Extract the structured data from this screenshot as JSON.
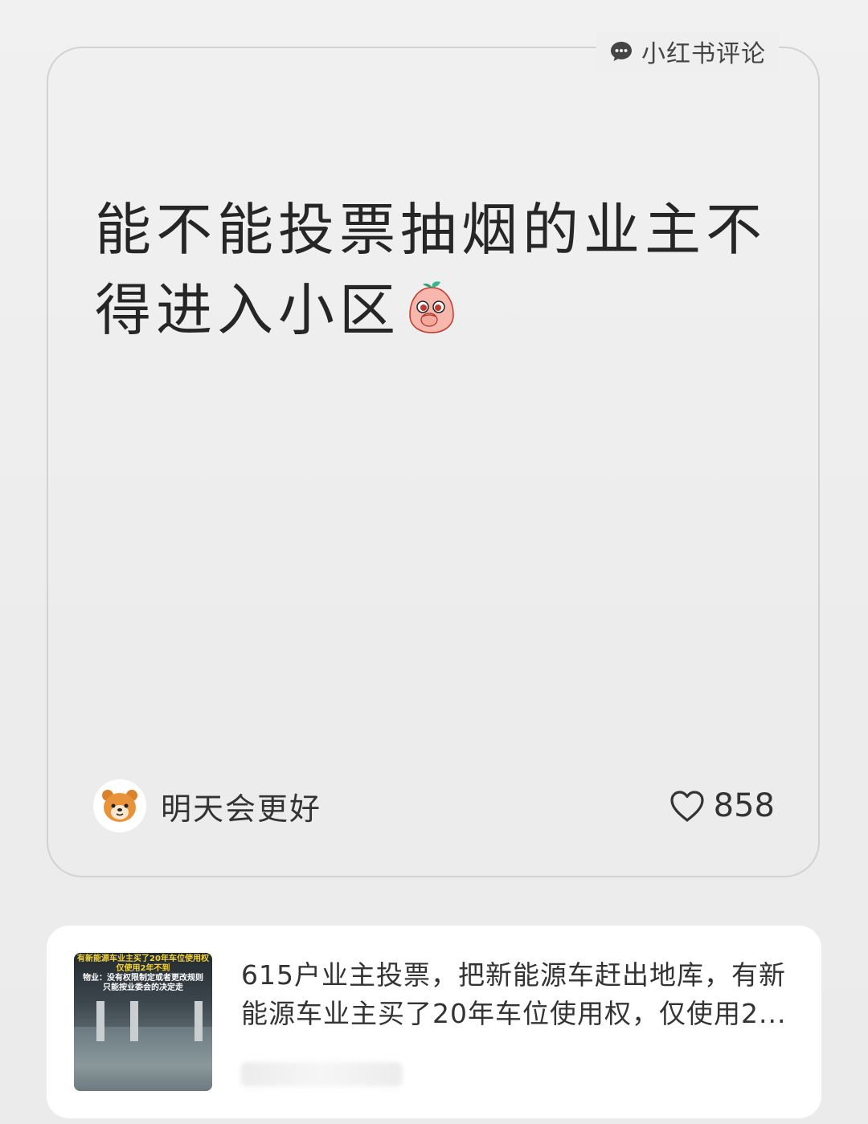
{
  "comment_card": {
    "source_label": "小红书评论",
    "source_icon": "chat-bubble-icon",
    "comment_text": "能不能投票抽烟的业主不得进入小区",
    "emoji": "peach-cover-mouth-emoji",
    "author_name": "明天会更好",
    "avatar_icon": "bear-avatar-icon",
    "like_icon": "heart-icon",
    "like_count": "858"
  },
  "note_card": {
    "thumb_banner_line1": "有新能源车业主买了20年车位使用权",
    "thumb_banner_line2": "仅使用2年不到",
    "thumb_banner_line3": "物业：没有权限制定或者更改规则",
    "thumb_banner_line4": "只能按业委会的决定走",
    "text": "615户业主投票，把新能源车赶出地库，有新能源车业主买了20年车位使用权，仅使用2..."
  },
  "colors": {
    "background": "#efefef",
    "card_border": "#d2d2d2",
    "text_primary": "#262626",
    "banner_yellow": "#f3d33a"
  }
}
